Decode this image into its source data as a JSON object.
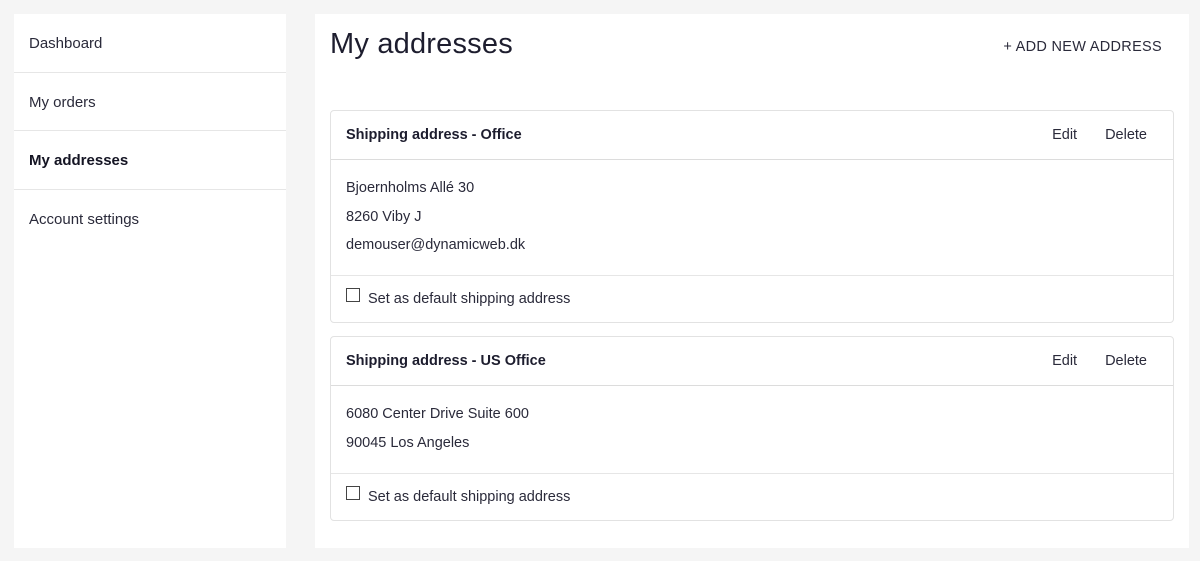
{
  "sidebar": {
    "items": [
      {
        "label": "Dashboard"
      },
      {
        "label": "My orders"
      },
      {
        "label": "My addresses"
      },
      {
        "label": "Account settings"
      }
    ]
  },
  "main": {
    "title": "My addresses",
    "add_button_label": "+ ADD NEW ADDRESS",
    "addresses": [
      {
        "title": "Shipping address - Office",
        "edit_label": "Edit",
        "delete_label": "Delete",
        "lines": [
          "Bjoernholms Allé 30",
          "8260 Viby J",
          "demouser@dynamicweb.dk"
        ],
        "default_label": "Set as default shipping address"
      },
      {
        "title": "Shipping address - US Office",
        "edit_label": "Edit",
        "delete_label": "Delete",
        "lines": [
          "6080 Center Drive Suite 600",
          "90045 Los Angeles"
        ],
        "default_label": "Set as default shipping address"
      }
    ]
  }
}
